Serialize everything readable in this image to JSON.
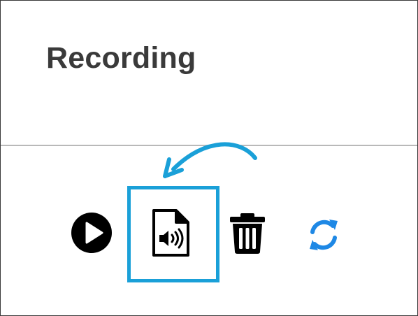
{
  "dialog": {
    "title": "Recording"
  },
  "toolbar": {
    "buttons": [
      {
        "icon": "play-icon",
        "color": "#000000"
      },
      {
        "icon": "audio-file-icon",
        "color": "#000000",
        "highlighted": true
      },
      {
        "icon": "trash-icon",
        "color": "#000000"
      },
      {
        "icon": "refresh-icon",
        "color": "#1e88e5"
      }
    ]
  },
  "annotation": {
    "highlight_color": "#1aa0d8",
    "arrow_color": "#1aa0d8",
    "arrow_icon": "curved-arrow-icon"
  }
}
